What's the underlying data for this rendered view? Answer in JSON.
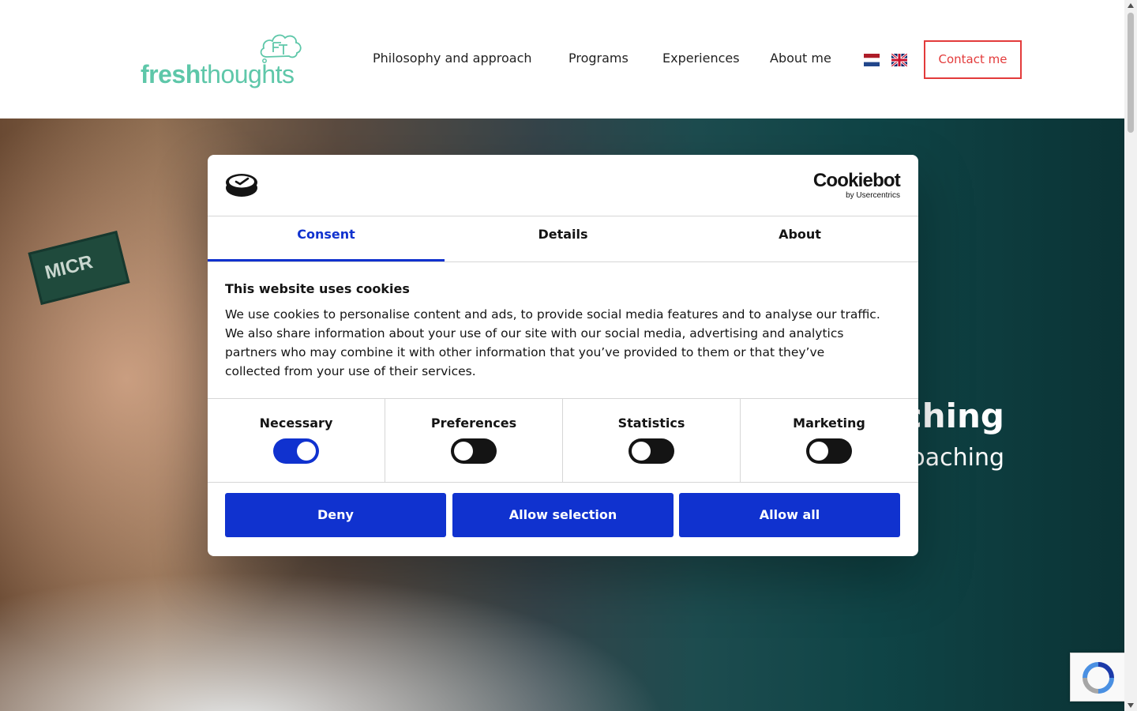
{
  "site": {
    "logo": {
      "bold": "fresh",
      "light": "thoughts",
      "icon": "fresh-thoughts-cloud-icon"
    },
    "nav": [
      "Philosophy and approach",
      "Programs",
      "Experiences",
      "About me"
    ],
    "languages": [
      {
        "name": "dutch-flag-icon"
      },
      {
        "name": "uk-flag-icon"
      }
    ],
    "contact_label": "Contact me",
    "hero": {
      "title_visible": "ching",
      "subtitle_visible": "oaching",
      "sign_text": "MICR"
    }
  },
  "cookie_dialog": {
    "brand": {
      "name": "Cookiebot",
      "by": "by Usercentrics"
    },
    "tabs": [
      "Consent",
      "Details",
      "About"
    ],
    "active_tab": "Consent",
    "title": "This website uses cookies",
    "body": "We use cookies to personalise content and ads, to provide social media features and to analyse our traffic. We also share information about your use of our site with our social media, advertising and analytics partners who may combine it with other information that you’ve provided to them or that they’ve collected from your use of their services.",
    "toggles": [
      {
        "label": "Necessary",
        "on": true
      },
      {
        "label": "Preferences",
        "on": false
      },
      {
        "label": "Statistics",
        "on": false
      },
      {
        "label": "Marketing",
        "on": false
      }
    ],
    "buttons": {
      "deny": "Deny",
      "allow_selection": "Allow selection",
      "allow_all": "Allow all"
    }
  },
  "colors": {
    "brand_green": "#5ec7a9",
    "contact_red": "#e33b3b",
    "cookiebot_blue": "#1032cf"
  }
}
